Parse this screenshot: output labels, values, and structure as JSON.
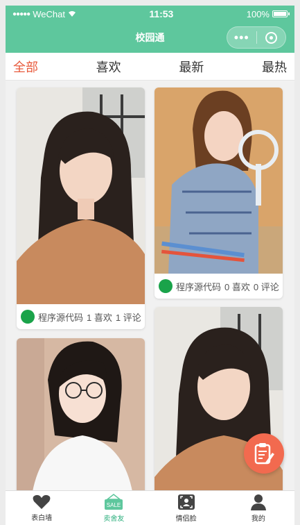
{
  "status": {
    "carrier": "WeChat",
    "time": "11:53",
    "battery": "100%"
  },
  "navbar": {
    "title": "校园通"
  },
  "tabs": [
    {
      "label": "全部",
      "active": true
    },
    {
      "label": "喜欢",
      "active": false
    },
    {
      "label": "最新",
      "active": false
    },
    {
      "label": "最热",
      "active": false
    }
  ],
  "posts": [
    {
      "author": "程序源代码",
      "likes": "1 喜欢",
      "comments": "1 评论"
    },
    {
      "author": "程序源代码",
      "likes": "0 喜欢",
      "comments": "0 评论"
    }
  ],
  "tabbar": [
    {
      "label": "表白墙",
      "icon": "heart-icon",
      "active": false
    },
    {
      "label": "卖舍友",
      "icon": "sale-tag-icon",
      "active": true
    },
    {
      "label": "情侣脸",
      "icon": "face-scan-icon",
      "active": false
    },
    {
      "label": "我的",
      "icon": "person-icon",
      "active": false
    }
  ],
  "colors": {
    "header": "#5ec79d",
    "active_tab": "#e85a3c",
    "fab": "#f26a4f",
    "tabbar_active": "#2fb07f"
  }
}
